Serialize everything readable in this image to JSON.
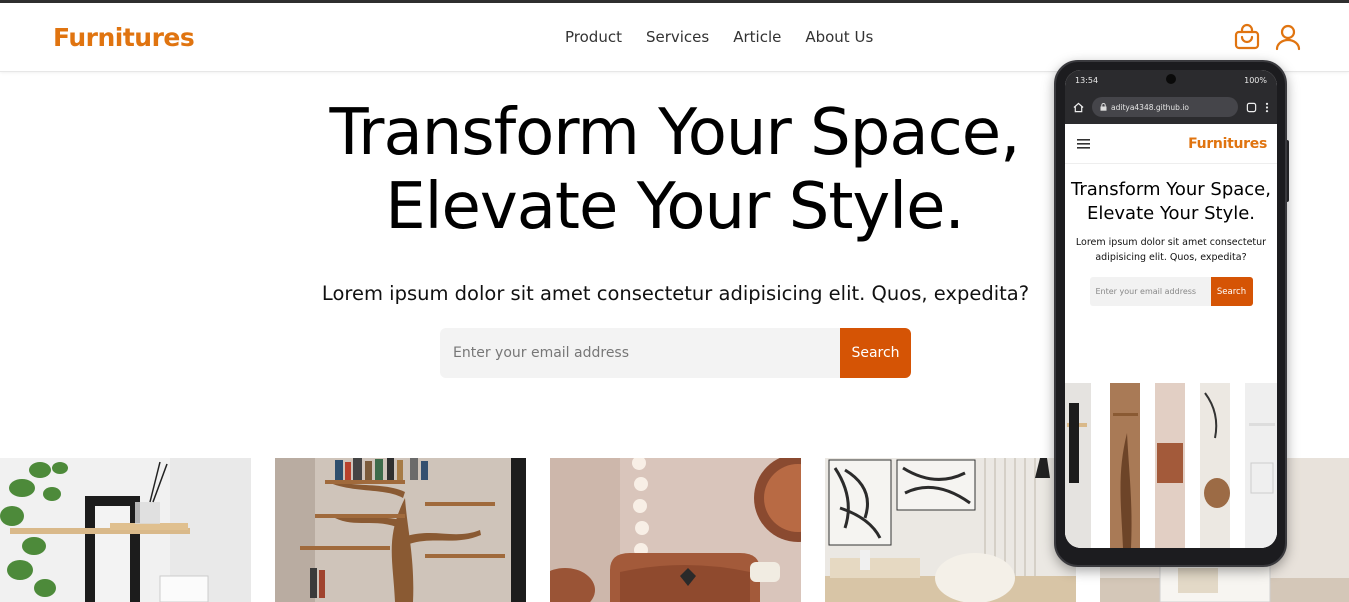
{
  "header": {
    "brand": "Furnitures",
    "nav": [
      "Product",
      "Services",
      "Article",
      "About Us"
    ],
    "icons": [
      "shopping-bag-icon",
      "user-icon"
    ],
    "accent": "#e07410"
  },
  "hero": {
    "title_line1": "Transform Your Space,",
    "title_line2": "Elevate Your Style.",
    "subtitle": "Lorem ipsum dolor sit amet consectetur adipisicing elit. Quos, expedita?",
    "email_placeholder": "Enter your email address",
    "search_label": "Search",
    "button_color": "#d55405"
  },
  "gallery": [
    "shelf-plant-photo",
    "tree-bookshelf-photo",
    "lounge-sofa-photo",
    "living-room-photo",
    "cabinet-photo"
  ],
  "phone": {
    "time": "13:54",
    "battery": "100%",
    "url": "aditya4348.github.io",
    "brand": "Furnitures",
    "title": "Transform Your Space, Elevate Your Style.",
    "subtitle": "Lorem ipsum dolor sit amet consectetur adipisicing elit. Quos, expedita?",
    "email_placeholder": "Enter your email address",
    "search_label": "Search"
  }
}
